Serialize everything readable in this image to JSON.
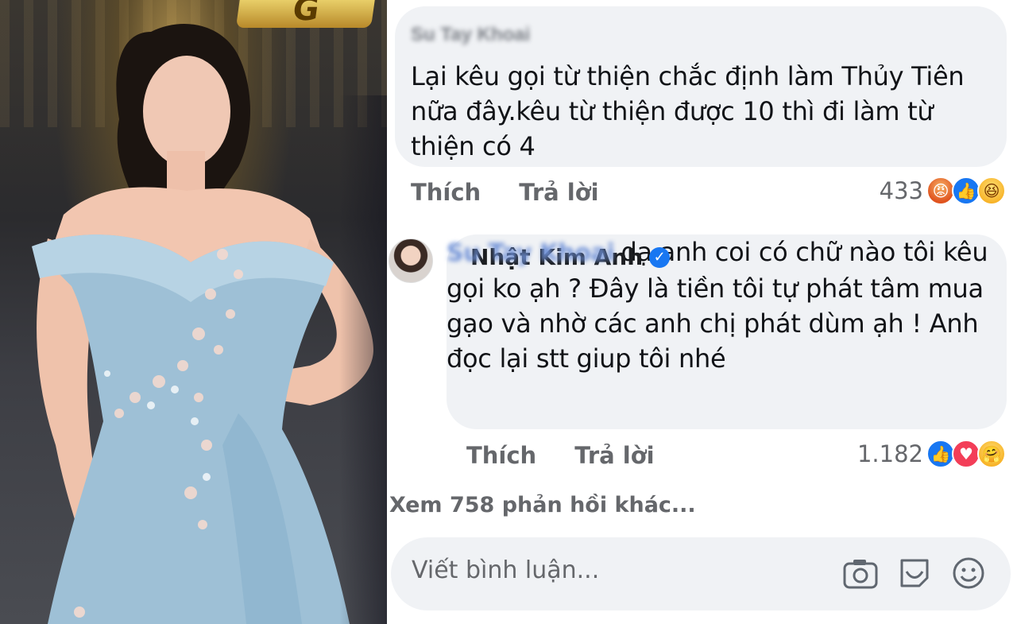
{
  "photo": {
    "alt": "Nhật Kim Anh",
    "sign_text": "G"
  },
  "comment1": {
    "author": "Su Tay Khoai",
    "text": "Lại kêu gọi từ thiện chắc định làm Thủy Tiên nữa đây.kêu từ thiện được 10 thì đi làm từ thiện có 4",
    "like_label": "Thích",
    "reply_label": "Trả lời",
    "reaction_count": "433",
    "reactions": [
      "angry-icon",
      "like-icon",
      "haha-icon"
    ]
  },
  "comment2": {
    "author": "Nhật Kim Anh",
    "verified": true,
    "mention": "Su Tay Khoai",
    "text": "dạ anh coi có chữ nào tôi kêu gọi ko ạh ? Đây là tiền tôi tự phát tâm mua gạo và nhờ các anh chị phát dùm ạh ! Anh đọc lại stt giup tôi nhé",
    "like_label": "Thích",
    "reply_label": "Trả lời",
    "reaction_count": "1.182",
    "reactions": [
      "like-icon",
      "love-icon",
      "care-icon"
    ]
  },
  "more_replies": "Xem 758 phản hồi khác...",
  "composer": {
    "placeholder": "Viết bình luận...",
    "icons": [
      "camera-icon",
      "gif-sticker-icon",
      "emoji-icon"
    ]
  },
  "colors": {
    "bubble": "#f0f2f5",
    "meta_text": "#65676b",
    "facebook_blue": "#1877f2"
  }
}
